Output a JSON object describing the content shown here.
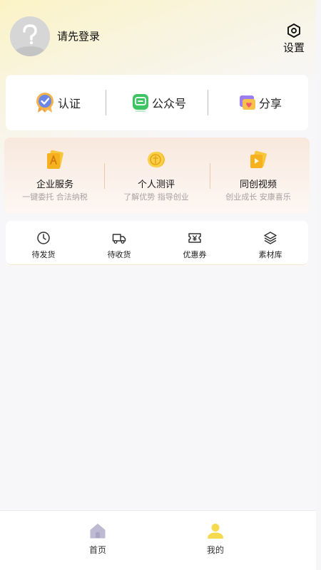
{
  "header": {
    "login_prompt": "请先登录",
    "avatar_icon": "default-avatar-question-icon",
    "settings_label": "设置",
    "settings_icon": "hexagon-settings-icon"
  },
  "quick_actions": [
    {
      "label": "认证",
      "icon": "certification-badge-icon"
    },
    {
      "label": "公众号",
      "icon": "wechat-official-account-icon"
    },
    {
      "label": "分享",
      "icon": "share-gift-icon"
    }
  ],
  "services": [
    {
      "title": "企业服务",
      "subtitle": "一键委托 合法纳税",
      "icon": "enterprise-service-icon"
    },
    {
      "title": "个人测评",
      "subtitle": "了解优势 指导创业",
      "icon": "personal-assessment-icon"
    },
    {
      "title": "同创视频",
      "subtitle": "创业成长 安康喜乐",
      "icon": "video-icon"
    }
  ],
  "shortcuts": [
    {
      "label": "待发货",
      "icon": "clock-icon"
    },
    {
      "label": "待收货",
      "icon": "delivery-truck-icon"
    },
    {
      "label": "优惠券",
      "icon": "coupon-icon"
    },
    {
      "label": "素材库",
      "icon": "layers-icon"
    }
  ],
  "tabs": [
    {
      "label": "首页",
      "icon": "home-icon",
      "active": false
    },
    {
      "label": "我的",
      "icon": "user-icon",
      "active": true
    }
  ],
  "colors": {
    "accent_yellow": "#f5d94f",
    "inactive_icon": "#bdbad2",
    "header_gradient": "#fbf3c6"
  }
}
